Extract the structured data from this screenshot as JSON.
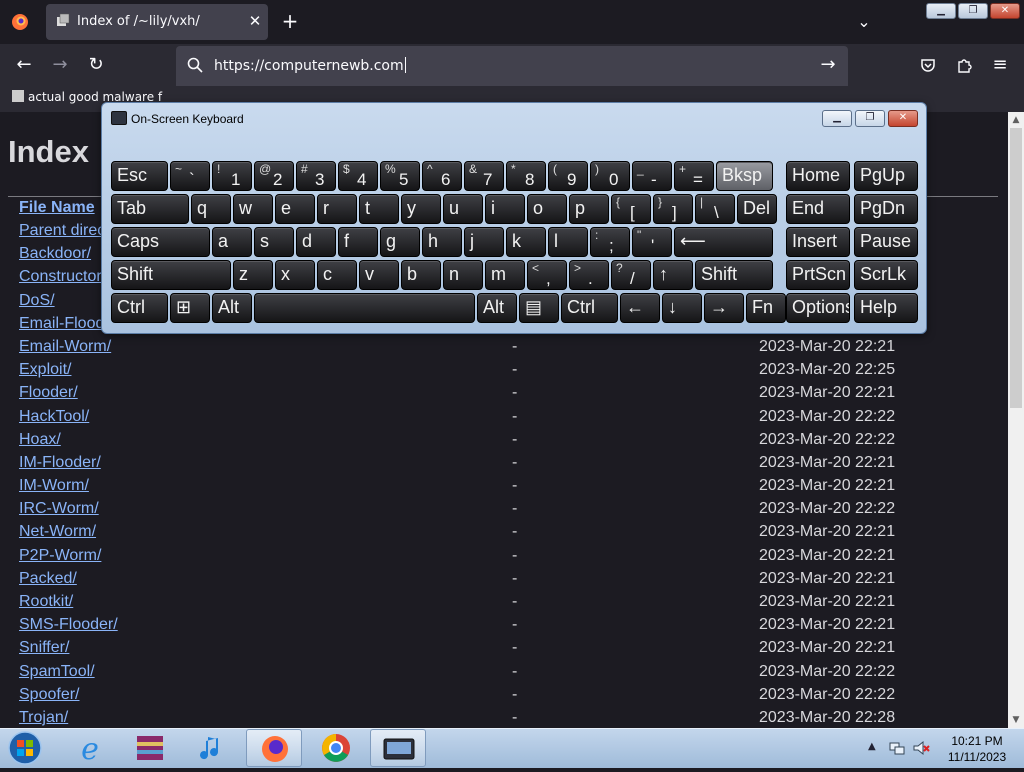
{
  "browser": {
    "tab_title": "Index of /~lily/vxh/",
    "tab_close": "✕",
    "new_tab": "+",
    "url": "https://computernewb.com",
    "bookmark": "actual good malware f",
    "window_buttons": {
      "minimize": "▁",
      "maximize": "❐",
      "close": "✕"
    }
  },
  "page": {
    "heading": "Index",
    "column_header": "File Name",
    "rows": [
      {
        "name": "Parent directory/",
        "size": "",
        "date": ""
      },
      {
        "name": "Backdoor/",
        "size": "",
        "date": ""
      },
      {
        "name": "Constructor/",
        "size": "",
        "date": ""
      },
      {
        "name": "DoS/",
        "size": "",
        "date": ""
      },
      {
        "name": "Email-Flooder/",
        "size": "",
        "date": ""
      },
      {
        "name": "Email-Worm/",
        "size": "-",
        "date": "2023-Mar-20 22:21"
      },
      {
        "name": "Exploit/",
        "size": "-",
        "date": "2023-Mar-20 22:25"
      },
      {
        "name": "Flooder/",
        "size": "-",
        "date": "2023-Mar-20 22:21"
      },
      {
        "name": "HackTool/",
        "size": "-",
        "date": "2023-Mar-20 22:22"
      },
      {
        "name": "Hoax/",
        "size": "-",
        "date": "2023-Mar-20 22:22"
      },
      {
        "name": "IM-Flooder/",
        "size": "-",
        "date": "2023-Mar-20 22:21"
      },
      {
        "name": "IM-Worm/",
        "size": "-",
        "date": "2023-Mar-20 22:21"
      },
      {
        "name": "IRC-Worm/",
        "size": "-",
        "date": "2023-Mar-20 22:22"
      },
      {
        "name": "Net-Worm/",
        "size": "-",
        "date": "2023-Mar-20 22:21"
      },
      {
        "name": "P2P-Worm/",
        "size": "-",
        "date": "2023-Mar-20 22:21"
      },
      {
        "name": "Packed/",
        "size": "-",
        "date": "2023-Mar-20 22:21"
      },
      {
        "name": "Rootkit/",
        "size": "-",
        "date": "2023-Mar-20 22:21"
      },
      {
        "name": "SMS-Flooder/",
        "size": "-",
        "date": "2023-Mar-20 22:21"
      },
      {
        "name": "Sniffer/",
        "size": "-",
        "date": "2023-Mar-20 22:21"
      },
      {
        "name": "SpamTool/",
        "size": "-",
        "date": "2023-Mar-20 22:22"
      },
      {
        "name": "Spoofer/",
        "size": "-",
        "date": "2023-Mar-20 22:22"
      },
      {
        "name": "Trojan/",
        "size": "-",
        "date": "2023-Mar-20 22:28"
      }
    ]
  },
  "osk": {
    "title": "On-Screen Keyboard",
    "buttons": {
      "minimize": "▁",
      "restore": "❐",
      "close": "✕"
    },
    "rows": [
      [
        {
          "main": "Esc",
          "w": 1.4
        },
        {
          "sh": "~",
          "lo": "`"
        },
        {
          "sh": "!",
          "lo": "1"
        },
        {
          "sh": "@",
          "lo": "2"
        },
        {
          "sh": "#",
          "lo": "3"
        },
        {
          "sh": "$",
          "lo": "4"
        },
        {
          "sh": "%",
          "lo": "5"
        },
        {
          "sh": "^",
          "lo": "6"
        },
        {
          "sh": "&",
          "lo": "7"
        },
        {
          "sh": "*",
          "lo": "8"
        },
        {
          "sh": "(",
          "lo": "9"
        },
        {
          "sh": ")",
          "lo": "0"
        },
        {
          "sh": "_",
          "lo": "-"
        },
        {
          "sh": "+",
          "lo": "="
        },
        {
          "main": "Bksp",
          "w": 1.4,
          "hl": true
        }
      ],
      [
        {
          "main": "Tab",
          "w": 1.9
        },
        {
          "main": "q"
        },
        {
          "main": "w"
        },
        {
          "main": "e"
        },
        {
          "main": "r"
        },
        {
          "main": "t"
        },
        {
          "main": "y"
        },
        {
          "main": "u"
        },
        {
          "main": "i"
        },
        {
          "main": "o"
        },
        {
          "main": "p"
        },
        {
          "sh": "{",
          "lo": "["
        },
        {
          "sh": "}",
          "lo": "]"
        },
        {
          "sh": "|",
          "lo": "\\"
        },
        {
          "main": "Del"
        }
      ],
      [
        {
          "main": "Caps",
          "w": 2.4
        },
        {
          "main": "a"
        },
        {
          "main": "s"
        },
        {
          "main": "d"
        },
        {
          "main": "f"
        },
        {
          "main": "g"
        },
        {
          "main": "h"
        },
        {
          "main": "j"
        },
        {
          "main": "k"
        },
        {
          "main": "l"
        },
        {
          "sh": ":",
          "lo": ";"
        },
        {
          "sh": "\"",
          "lo": "'"
        },
        {
          "main": "⟵",
          "w": 2.4
        }
      ],
      [
        {
          "main": "Shift",
          "w": 2.9
        },
        {
          "main": "z"
        },
        {
          "main": "x"
        },
        {
          "main": "c"
        },
        {
          "main": "v"
        },
        {
          "main": "b"
        },
        {
          "main": "n"
        },
        {
          "main": "m"
        },
        {
          "sh": "<",
          "lo": ","
        },
        {
          "sh": ">",
          "lo": "."
        },
        {
          "sh": "?",
          "lo": "/"
        },
        {
          "main": "↑"
        },
        {
          "main": "Shift",
          "w": 1.9
        }
      ],
      [
        {
          "main": "Ctrl",
          "w": 1.4
        },
        {
          "main": "⊞"
        },
        {
          "main": "Alt"
        },
        {
          "main": "",
          "w": 5.3
        },
        {
          "main": "Alt"
        },
        {
          "main": "▤"
        },
        {
          "main": "Ctrl",
          "w": 1.4
        },
        {
          "main": "←"
        },
        {
          "main": "↓"
        },
        {
          "main": "→"
        },
        {
          "main": "Fn"
        }
      ]
    ],
    "side_rows": [
      [
        "Home",
        "PgUp"
      ],
      [
        "End",
        "PgDn"
      ],
      [
        "Insert",
        "Pause"
      ],
      [
        "PrtScn",
        "ScrLk"
      ],
      [
        "Options",
        "Help"
      ]
    ]
  },
  "taskbar": {
    "time": "10:21 PM",
    "date": "11/11/2023",
    "tray_arrow": "▲"
  }
}
